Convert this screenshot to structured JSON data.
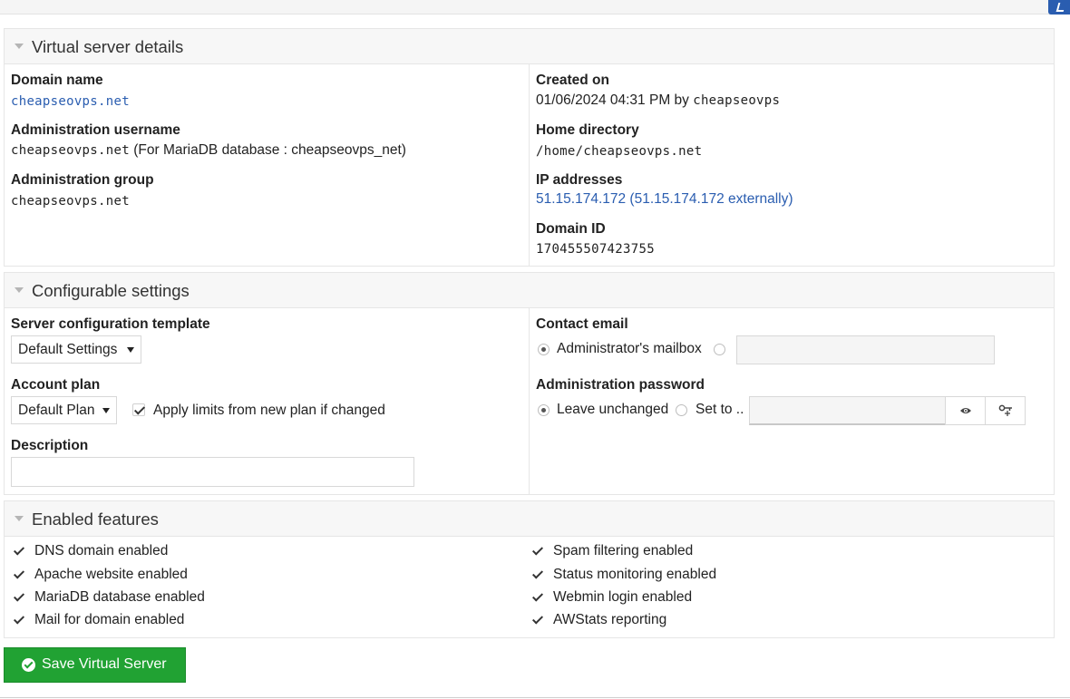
{
  "vs_details": {
    "title": "Virtual server details",
    "domain_name_label": "Domain name",
    "domain_name": "cheapseovps.net",
    "admin_user_label": "Administration username",
    "admin_user": "cheapseovps.net",
    "admin_user_note": "(For MariaDB database : cheapseovps_net)",
    "admin_group_label": "Administration group",
    "admin_group": "cheapseovps.net",
    "created_label": "Created on",
    "created_date": "01/06/2024 04:31 PM by",
    "created_by": "cheapseovps",
    "home_label": "Home directory",
    "home_dir": "/home/cheapseovps.net",
    "ip_label": "IP addresses",
    "ip_value": "51.15.174.172 (51.15.174.172 externally)",
    "domain_id_label": "Domain ID",
    "domain_id": "170455507423755"
  },
  "config": {
    "title": "Configurable settings",
    "template_label": "Server configuration template",
    "template_value": "Default Settings",
    "plan_label": "Account plan",
    "plan_value": "Default Plan",
    "apply_limits_label": "Apply limits from new plan if changed",
    "apply_limits_checked": true,
    "description_label": "Description",
    "description_value": "",
    "contact_label": "Contact email",
    "contact_option_mailbox": "Administrator's mailbox",
    "contact_email_value": "",
    "password_label": "Administration password",
    "password_option_unchanged": "Leave unchanged",
    "password_option_set": "Set to ..",
    "password_value": ""
  },
  "features": {
    "title": "Enabled features",
    "left": [
      "DNS domain enabled",
      "Apache website enabled",
      "MariaDB database enabled",
      "Mail for domain enabled"
    ],
    "right": [
      "Spam filtering enabled",
      "Status monitoring enabled",
      "Webmin login enabled",
      "AWStats reporting"
    ]
  },
  "save_button": "Save Virtual Server",
  "colors": {
    "link": "#2a5db0",
    "save_button": "#21a233",
    "corner_icon": "#2a5db0"
  },
  "icons": {
    "collapse": "triangle-down-icon",
    "checkbox": "check-icon",
    "show_password": "eye-icon",
    "generate_password": "key-icon",
    "save": "check-circle-icon"
  }
}
